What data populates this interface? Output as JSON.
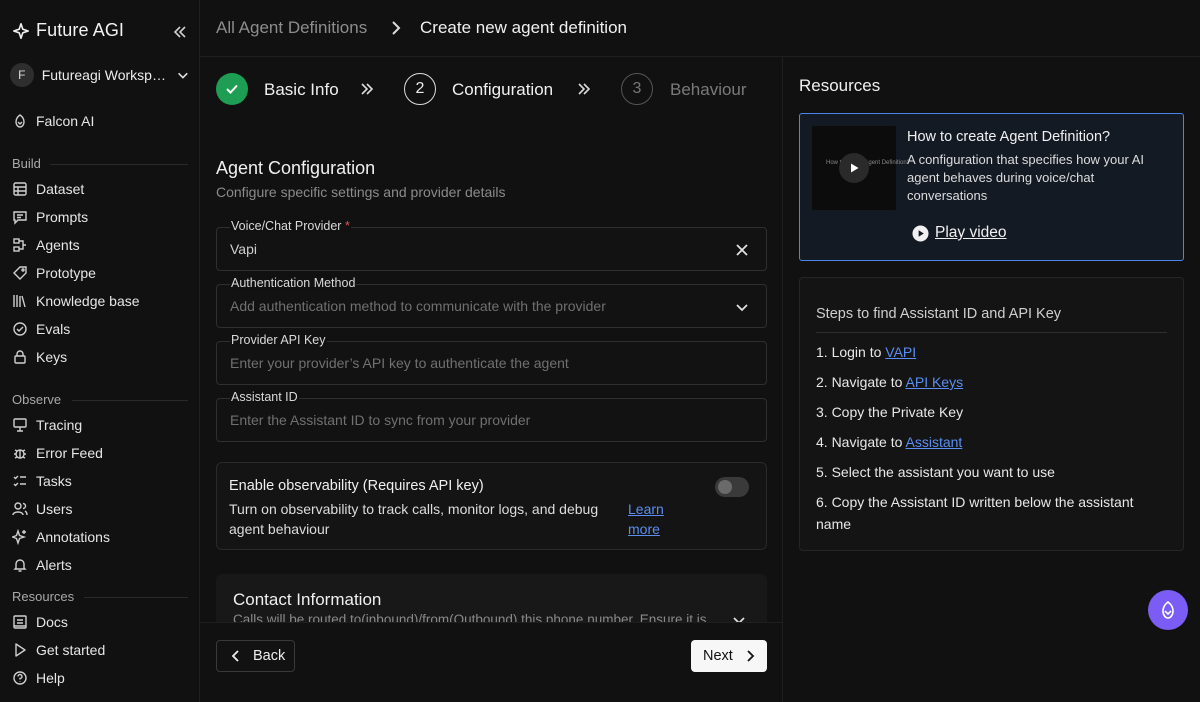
{
  "app": {
    "name": "Future AGI"
  },
  "workspace": {
    "initial": "F",
    "name": "Futureagi Workspace"
  },
  "sidebar": {
    "top_item": "Falcon AI",
    "sections": {
      "build": "Build",
      "observe": "Observe",
      "resources": "Resources"
    },
    "build_items": [
      "Dataset",
      "Prompts",
      "Agents",
      "Prototype",
      "Knowledge base",
      "Evals",
      "Keys"
    ],
    "observe_items": [
      "Tracing",
      "Error Feed",
      "Tasks",
      "Users",
      "Annotations",
      "Alerts"
    ],
    "resource_items": [
      "Docs",
      "Get started",
      "Help"
    ]
  },
  "breadcrumb": {
    "parent": "All Agent Definitions",
    "current": "Create new agent definition"
  },
  "stepper": [
    {
      "number": "1",
      "label": "Basic Info",
      "state": "done"
    },
    {
      "number": "2",
      "label": "Configuration",
      "state": "active"
    },
    {
      "number": "3",
      "label": "Behaviour",
      "state": "idle"
    }
  ],
  "form": {
    "title": "Agent Configuration",
    "subtitle": "Configure specific settings and provider details",
    "provider": {
      "label": "Voice/Chat Provider",
      "required_mark": "*",
      "value": "Vapi"
    },
    "auth": {
      "label": "Authentication Method",
      "placeholder": "Add authentication method to communicate with the provider"
    },
    "api_key": {
      "label": "Provider API Key",
      "placeholder": "Enter your provider’s API key to authenticate the agent"
    },
    "assistant_id": {
      "label": "Assistant ID",
      "placeholder": "Enter the Assistant ID to sync from your provider"
    },
    "observability": {
      "title": "Enable observability (Requires API key)",
      "description": "Turn on observability to track calls, monitor logs, and debug agent behaviour",
      "link": "Learn more",
      "enabled": false
    },
    "contact": {
      "title": "Contact Information",
      "description": "Calls will be routed to(inbound)/from(Outbound) this phone number. Ensure it is"
    }
  },
  "buttons": {
    "back": "Back",
    "next": "Next"
  },
  "resources": {
    "title": "Resources",
    "video": {
      "title": "How to create Agent Definition?",
      "description": "A configuration that specifies how your AI agent behaves during voice/chat conversations",
      "thumb_text": "How to create Agent Definition?",
      "play": "Play video"
    },
    "steps_title": "Steps to find Assistant ID and API Key",
    "steps": [
      {
        "prefix": "1. Login to ",
        "link": "VAPI",
        "suffix": ""
      },
      {
        "prefix": "2. Navigate to ",
        "link": "API Keys",
        "suffix": ""
      },
      {
        "prefix": "3. Copy the Private Key",
        "link": "",
        "suffix": ""
      },
      {
        "prefix": "4. Navigate to ",
        "link": "Assistant",
        "suffix": ""
      },
      {
        "prefix": "5. Select the assistant you want to use",
        "link": "",
        "suffix": ""
      },
      {
        "prefix": "6. Copy the Assistant ID written below the assistant name",
        "link": "",
        "suffix": ""
      }
    ]
  },
  "colors": {
    "accent_blue": "#4a86e8",
    "link": "#5b8ef0",
    "success": "#1e9e54",
    "fab": "#7b5cf5",
    "required": "#e05555"
  }
}
